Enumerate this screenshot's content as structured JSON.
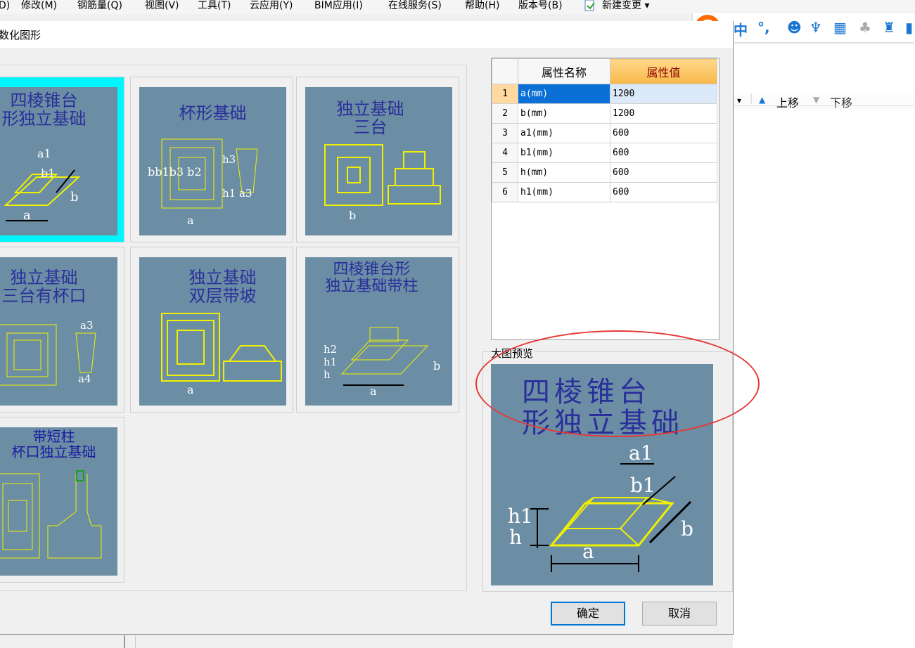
{
  "menubar": {
    "items": [
      "D)",
      "修改(M)",
      "钢筋量(Q)",
      "视图(V)",
      "工具(T)",
      "云应用(Y)",
      "BIM应用(I)",
      "在线服务(S)",
      "帮助(H)",
      "版本号(B)",
      "新建变更 ▾"
    ]
  },
  "ime": {
    "logo": "S",
    "lang": "中",
    "punct": "°,",
    "emoji": "☻",
    "mic": "♆",
    "keyboard": "▦",
    "user": "♣",
    "skin": "♜"
  },
  "background_toolbar": {
    "up_label": "上移",
    "down_label": "下移"
  },
  "dialog": {
    "title": "数化图形",
    "thumbnails": [
      {
        "title": "四棱锥台\n形独立基础"
      },
      {
        "title": "杯形基础"
      },
      {
        "title": "独立基础\n三台"
      },
      {
        "title": "独立基础\n三台有杯口"
      },
      {
        "title": "独立基础\n双层带坡"
      },
      {
        "title": "四棱锥台形\n独立基础带柱"
      },
      {
        "title": "带短柱\n杯口独立基础"
      }
    ],
    "property_table": {
      "headers": [
        "属性名称",
        "属性值"
      ],
      "rows": [
        {
          "index": "1",
          "name": "a(mm)",
          "value": "1200"
        },
        {
          "index": "2",
          "name": "b(mm)",
          "value": "1200"
        },
        {
          "index": "3",
          "name": "a1(mm)",
          "value": "600"
        },
        {
          "index": "4",
          "name": "b1(mm)",
          "value": "600"
        },
        {
          "index": "5",
          "name": "h(mm)",
          "value": "600"
        },
        {
          "index": "6",
          "name": "h1(mm)",
          "value": "600"
        }
      ]
    },
    "preview": {
      "label": "大图预览",
      "title_line1": "四棱锥台",
      "title_line2": "形独立基础",
      "dims": {
        "a1": "a1",
        "b1": "b1",
        "h1": "h1",
        "h": "h",
        "a": "a",
        "b": "b"
      }
    },
    "ok_label": "确定",
    "cancel_label": "取消"
  },
  "colors": {
    "accent": "#0078d7",
    "thumb_bg": "#6b8ea5",
    "selected": "#00f5ff",
    "drawing": "#f0f000",
    "highlight_oval": "#e53935"
  }
}
